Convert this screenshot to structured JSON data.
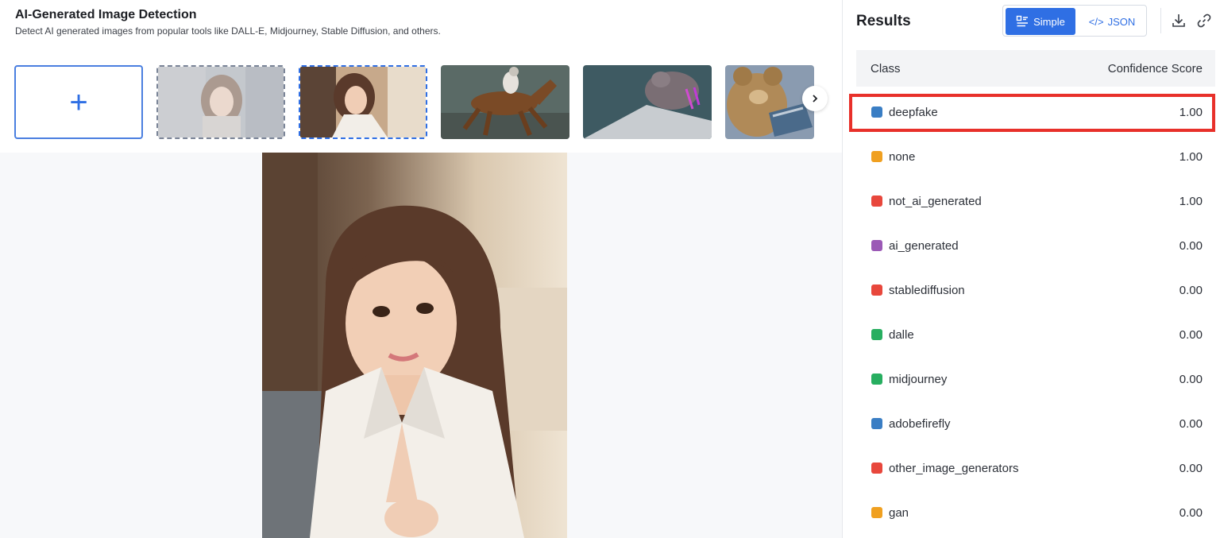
{
  "header": {
    "title": "AI-Generated Image Detection",
    "subtitle": "Detect AI generated images from popular tools like DALL-E, Midjourney, Stable Diffusion, and others."
  },
  "gallery": {
    "add_label": "+",
    "thumbnails": [
      "woman-portrait-faded",
      "woman-selfie-selected",
      "jockey-horse",
      "pigeon-on-paper",
      "teddy-bear-laptop"
    ]
  },
  "results": {
    "title": "Results",
    "view_simple": "Simple",
    "view_json": "JSON",
    "json_prefix": "</>",
    "columns": {
      "class": "Class",
      "score": "Confidence Score"
    },
    "rows": [
      {
        "label": "deepfake",
        "score": "1.00",
        "color": "#3a7ec4"
      },
      {
        "label": "none",
        "score": "1.00",
        "color": "#f0a020"
      },
      {
        "label": "not_ai_generated",
        "score": "1.00",
        "color": "#e8473c"
      },
      {
        "label": "ai_generated",
        "score": "0.00",
        "color": "#9b59b6"
      },
      {
        "label": "stablediffusion",
        "score": "0.00",
        "color": "#e8473c"
      },
      {
        "label": "dalle",
        "score": "0.00",
        "color": "#27ae60"
      },
      {
        "label": "midjourney",
        "score": "0.00",
        "color": "#27ae60"
      },
      {
        "label": "adobefirefly",
        "score": "0.00",
        "color": "#3a7ec4"
      },
      {
        "label": "other_image_generators",
        "score": "0.00",
        "color": "#e8473c"
      },
      {
        "label": "gan",
        "score": "0.00",
        "color": "#f0a020"
      }
    ]
  }
}
